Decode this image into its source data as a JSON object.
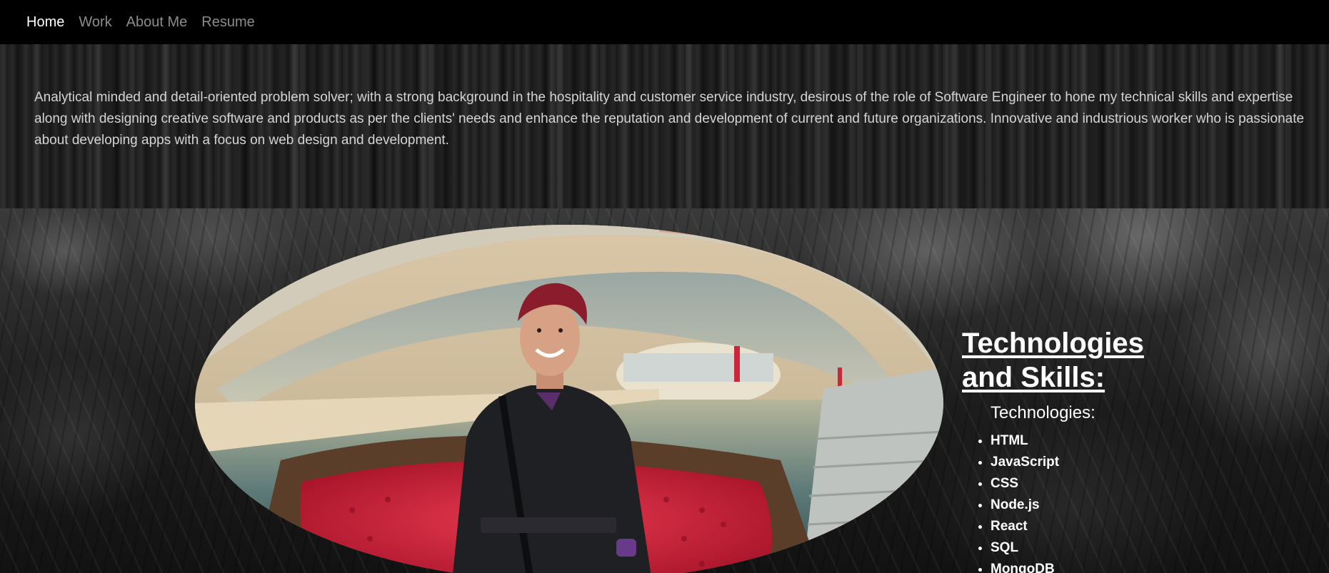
{
  "nav": {
    "items": [
      {
        "label": "Home",
        "active": true
      },
      {
        "label": "Work",
        "active": false
      },
      {
        "label": "About Me",
        "active": false
      },
      {
        "label": "Resume",
        "active": false
      }
    ]
  },
  "bio": {
    "text": "Analytical minded and detail-oriented problem solver; with a strong background in the hospitality and customer service industry, desirous of the role of Software Engineer to hone my technical skills and expertise along with designing creative software and products as per the clients' needs and enhance the reputation and development of current and future organizations. Innovative and industrious worker who is passionate about developing apps with a focus on web design and development."
  },
  "skills": {
    "heading": "Technologies and Skills:",
    "subheading": "Technologies:",
    "items": [
      "HTML",
      "JavaScript",
      "CSS",
      "Node.js",
      "React",
      "SQL",
      "MongoDB"
    ]
  },
  "photo": {
    "icon": "profile-photo"
  },
  "colors": {
    "nav_active": "#ffffff",
    "nav_inactive": "#8c8c8c",
    "bio_text": "#d4d4d4",
    "seat_red": "#d8203a"
  }
}
